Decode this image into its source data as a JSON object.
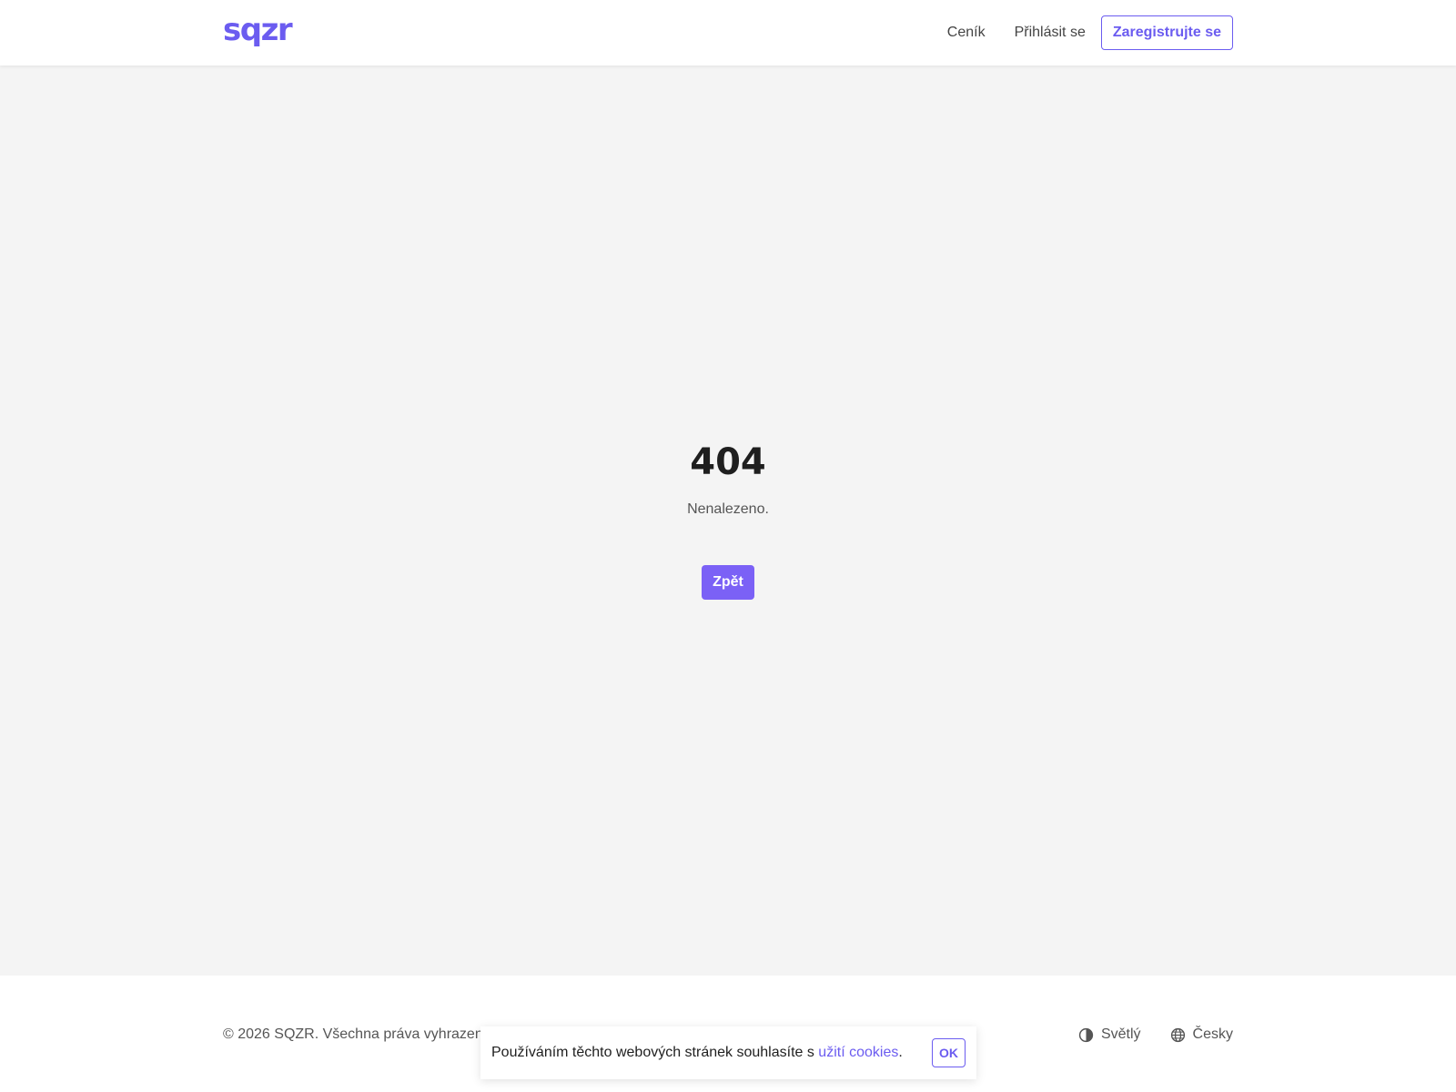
{
  "header": {
    "logo": "sqzr",
    "nav": {
      "pricing": "Ceník",
      "login": "Přihlásit se",
      "signup": "Zaregistrujte se"
    }
  },
  "main": {
    "code": "404",
    "message": "Nenalezeno.",
    "back_label": "Zpět"
  },
  "footer": {
    "copyright": "© 2026 SQZR. Všechna práva vyhrazena",
    "theme": {
      "label": "Světlý",
      "icon": "contrast-icon"
    },
    "language": {
      "label": "Česky",
      "icon": "globe-icon"
    }
  },
  "cookie_banner": {
    "text": "Používáním těchto webových stránek souhlasíte s ",
    "link": "užití cookies",
    "suffix": ".",
    "ok_label": "OK"
  },
  "colors": {
    "accent": "#6b5cf0",
    "button_bg": "#7b61f6",
    "page_bg": "#f4f4f4"
  }
}
